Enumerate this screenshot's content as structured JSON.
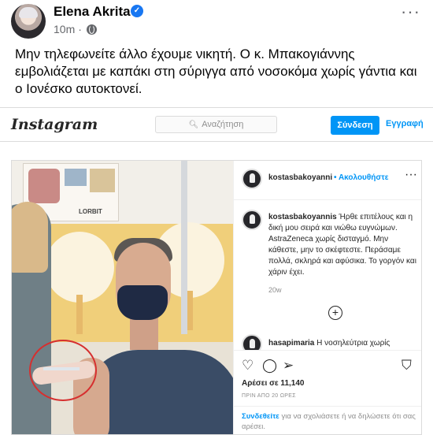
{
  "fb": {
    "author": "Elena Akrita",
    "time": "10m",
    "separator": "·",
    "text": "Μην τηλεφωνείτε άλλο έχουμε νικητή. Ο κ. Μπακογιάννης εμβολιάζεται με καπάκι στη σύριγγα από νοσοκόμα χωρίς γάντια και ο Ιονέσκο αυτοκτονεί."
  },
  "ig": {
    "logo": "Instagram",
    "search_placeholder": "Αναζήτηση",
    "login_button": "Σύνδεση",
    "signup_link": "Εγγραφή",
    "post": {
      "username": "kostasbakoyanni",
      "follow_separator": "•",
      "follow_label": "Ακολουθήστε",
      "caption_user": "kostasbakoyannis",
      "caption_text": "Ήρθε επιτέλους και η δική μου σειρά και νιώθω ευγνώμων. AstraZeneca χωρίς δισταγμό. Μην κάθεστε, μην το σκέφτεστε. Περάσαμε πολλά, σκληρά και αφύσικα. Το γοργόν και χάριν έχει.",
      "caption_time": "20w",
      "comment_user": "hasapimaria",
      "comment_text": "Η νοσηλεύτρια χωρίς",
      "likes": "Αρέσει σε 11,140",
      "time_ago": "ΠΡΙΝ ΑΠΟ 20 ΩΡΕΣ",
      "login_link": "Συνδεθείτε",
      "login_text": "για να σχολιάσετε ή να δηλώσετε ότι σας αρέσει.",
      "poster_text": "LORBIT"
    }
  },
  "colors": {
    "fb_blue": "#1877f2",
    "ig_blue": "#0095f6",
    "annotation_red": "#d62f2f"
  }
}
